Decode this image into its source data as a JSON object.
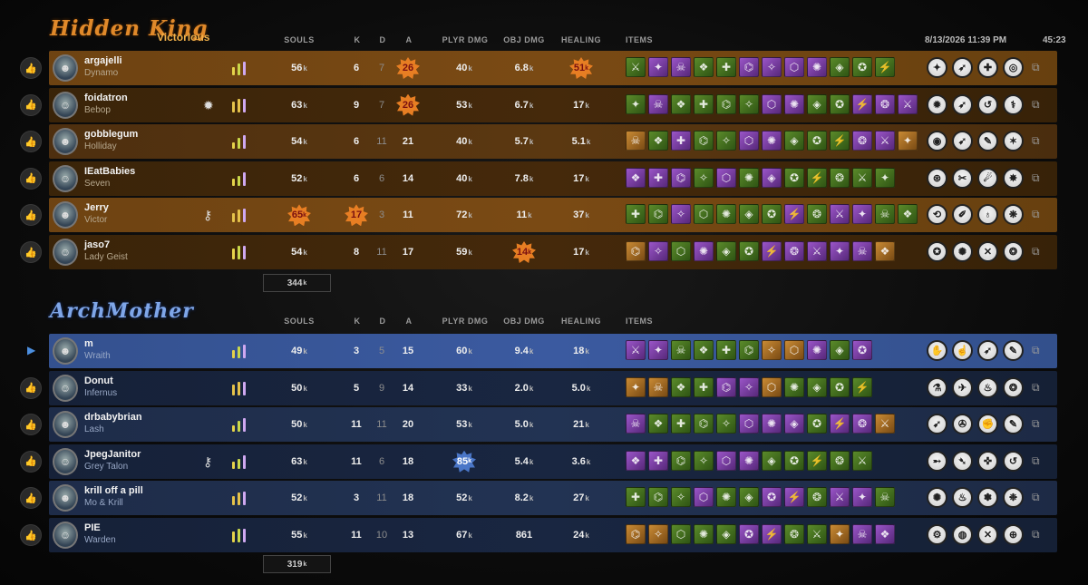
{
  "match": {
    "date": "8/13/2026 11:39 PM",
    "duration": "45:23"
  },
  "headers": {
    "souls": "SOULS",
    "kills": "K",
    "deaths": "D",
    "assists": "A",
    "player_damage": "PLYR DMG",
    "objective_damage": "OBJ DMG",
    "healing": "HEALING",
    "items": "ITEMS"
  },
  "teams": [
    {
      "name": "Hidden King",
      "result": "Victorious",
      "total_souls": "344",
      "total_suffix": "k",
      "players": [
        {
          "name": "argajelli",
          "hero": "Dynamo",
          "souls": "56",
          "k": "6",
          "d": "7",
          "a": "26",
          "plyr_dmg": "40",
          "obj_dmg": "6.8",
          "healing": "51",
          "items": [
            "g",
            "p",
            "p",
            "g",
            "g",
            "p",
            "p",
            "p",
            "p",
            "g",
            "g",
            "g"
          ],
          "abilities": [
            "✦",
            "➶",
            "✚",
            "◎"
          ]
        },
        {
          "name": "foidatron",
          "hero": "Bebop",
          "souls": "63",
          "k": "9",
          "d": "7",
          "a": "26",
          "plyr_dmg": "53",
          "obj_dmg": "6.7",
          "healing": "17",
          "items": [
            "g",
            "p",
            "g",
            "g",
            "g",
            "g",
            "p",
            "p",
            "g",
            "g",
            "p",
            "p",
            "p"
          ],
          "abilities": [
            "✹",
            "➶",
            "↺",
            "⚕"
          ]
        },
        {
          "name": "gobblegum",
          "hero": "Holliday",
          "souls": "54",
          "k": "6",
          "d": "11",
          "a": "21",
          "plyr_dmg": "40",
          "obj_dmg": "5.7",
          "healing": "5.1",
          "items": [
            "o",
            "g",
            "p",
            "g",
            "g",
            "p",
            "p",
            "g",
            "g",
            "g",
            "p",
            "p",
            "o"
          ],
          "abilities": [
            "◉",
            "➹",
            "✎",
            "✶"
          ]
        },
        {
          "name": "IEatBabies",
          "hero": "Seven",
          "souls": "52",
          "k": "6",
          "d": "6",
          "a": "14",
          "plyr_dmg": "40",
          "obj_dmg": "7.8",
          "healing": "17",
          "items": [
            "p",
            "p",
            "p",
            "g",
            "p",
            "g",
            "p",
            "g",
            "g",
            "g",
            "g",
            "g"
          ],
          "abilities": [
            "⊛",
            "✂",
            "☄",
            "✸"
          ]
        },
        {
          "name": "Jerry",
          "hero": "Victor",
          "souls": "65",
          "k": "17",
          "d": "3",
          "a": "11",
          "plyr_dmg": "72",
          "obj_dmg": "11",
          "healing": "37",
          "items": [
            "g",
            "g",
            "p",
            "g",
            "g",
            "g",
            "g",
            "p",
            "g",
            "p",
            "p",
            "g",
            "g"
          ],
          "abilities": [
            "⟲",
            "✐",
            "♁",
            "❋"
          ]
        },
        {
          "name": "jaso7",
          "hero": "Lady Geist",
          "souls": "54",
          "k": "8",
          "d": "11",
          "a": "17",
          "plyr_dmg": "59",
          "obj_dmg": "14",
          "healing": "17",
          "items": [
            "o",
            "p",
            "g",
            "p",
            "g",
            "g",
            "p",
            "p",
            "p",
            "p",
            "p",
            "o"
          ],
          "abilities": [
            "✪",
            "✺",
            "✕",
            "❂"
          ]
        }
      ]
    },
    {
      "name": "ArchMother",
      "result": "",
      "total_souls": "319",
      "total_suffix": "k",
      "players": [
        {
          "name": "m",
          "hero": "Wraith",
          "souls": "49",
          "k": "3",
          "d": "5",
          "a": "15",
          "plyr_dmg": "60",
          "obj_dmg": "9.4",
          "healing": "18",
          "items": [
            "p",
            "p",
            "g",
            "g",
            "g",
            "g",
            "o",
            "o",
            "p",
            "g",
            "p"
          ],
          "abilities": [
            "✋",
            "☝",
            "➶",
            "✎"
          ]
        },
        {
          "name": "Donut",
          "hero": "Infernus",
          "souls": "50",
          "k": "5",
          "d": "9",
          "a": "14",
          "plyr_dmg": "33",
          "obj_dmg": "2.0",
          "healing": "5.0",
          "items": [
            "o",
            "o",
            "g",
            "g",
            "p",
            "p",
            "o",
            "g",
            "g",
            "g",
            "g"
          ],
          "abilities": [
            "⚗",
            "✈",
            "♨",
            "❂"
          ]
        },
        {
          "name": "drbabybrian",
          "hero": "Lash",
          "souls": "50",
          "k": "11",
          "d": "11",
          "a": "20",
          "plyr_dmg": "53",
          "obj_dmg": "5.0",
          "healing": "21",
          "items": [
            "p",
            "g",
            "g",
            "g",
            "g",
            "p",
            "p",
            "p",
            "g",
            "p",
            "p",
            "o"
          ],
          "abilities": [
            "➹",
            "✇",
            "✊",
            "✎"
          ]
        },
        {
          "name": "JpegJanitor",
          "hero": "Grey Talon",
          "souls": "63",
          "k": "11",
          "d": "6",
          "a": "18",
          "plyr_dmg": "85",
          "obj_dmg": "5.4",
          "healing": "3.6",
          "items": [
            "p",
            "p",
            "g",
            "g",
            "p",
            "p",
            "g",
            "g",
            "g",
            "g",
            "g"
          ],
          "abilities": [
            "➵",
            "➴",
            "✜",
            "↺"
          ]
        },
        {
          "name": "krill off a pill",
          "hero": "Mo & Krill",
          "souls": "52",
          "k": "3",
          "d": "11",
          "a": "18",
          "plyr_dmg": "52",
          "obj_dmg": "8.2",
          "healing": "27",
          "items": [
            "g",
            "g",
            "g",
            "p",
            "g",
            "g",
            "p",
            "p",
            "g",
            "p",
            "p",
            "g"
          ],
          "abilities": [
            "✺",
            "♨",
            "✽",
            "❉"
          ]
        },
        {
          "name": "PIE",
          "hero": "Warden",
          "souls": "55",
          "k": "11",
          "d": "10",
          "a": "13",
          "plyr_dmg": "67",
          "obj_dmg": "861",
          "healing": "24",
          "items": [
            "o",
            "o",
            "g",
            "g",
            "g",
            "p",
            "p",
            "g",
            "g",
            "o",
            "p",
            "p"
          ],
          "abilities": [
            "⚙",
            "◍",
            "✕",
            "⊕"
          ]
        }
      ]
    }
  ]
}
